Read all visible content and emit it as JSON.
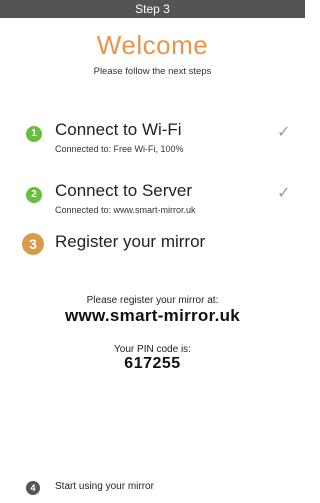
{
  "topbar": {
    "title": "Step 3"
  },
  "header": {
    "title": "Welcome",
    "subtitle": "Please follow the next steps"
  },
  "steps": [
    {
      "number": "1",
      "title": "Connect to Wi-Fi",
      "detail": "Connected to: Free Wi-Fi, 100%",
      "status": "done",
      "badge_color": "#68bf3c"
    },
    {
      "number": "2",
      "title": "Connect to Server",
      "detail": "Connected to: www.smart-mirror.uk",
      "status": "done",
      "badge_color": "#68bf3c"
    },
    {
      "number": "3",
      "title": "Register your mirror",
      "status": "current",
      "badge_color": "#d99a4b"
    },
    {
      "number": "4",
      "title": "Start using your mirror",
      "status": "pending",
      "badge_color": "#555555"
    }
  ],
  "registration": {
    "prompt": "Please register your mirror at:",
    "url": "www.smart-mirror.uk",
    "pin_label": "Your PIN code is:",
    "pin": "617255"
  },
  "icons": {
    "done": "check-icon"
  },
  "colors": {
    "accent": "#e8954c",
    "topbar": "#545454"
  }
}
